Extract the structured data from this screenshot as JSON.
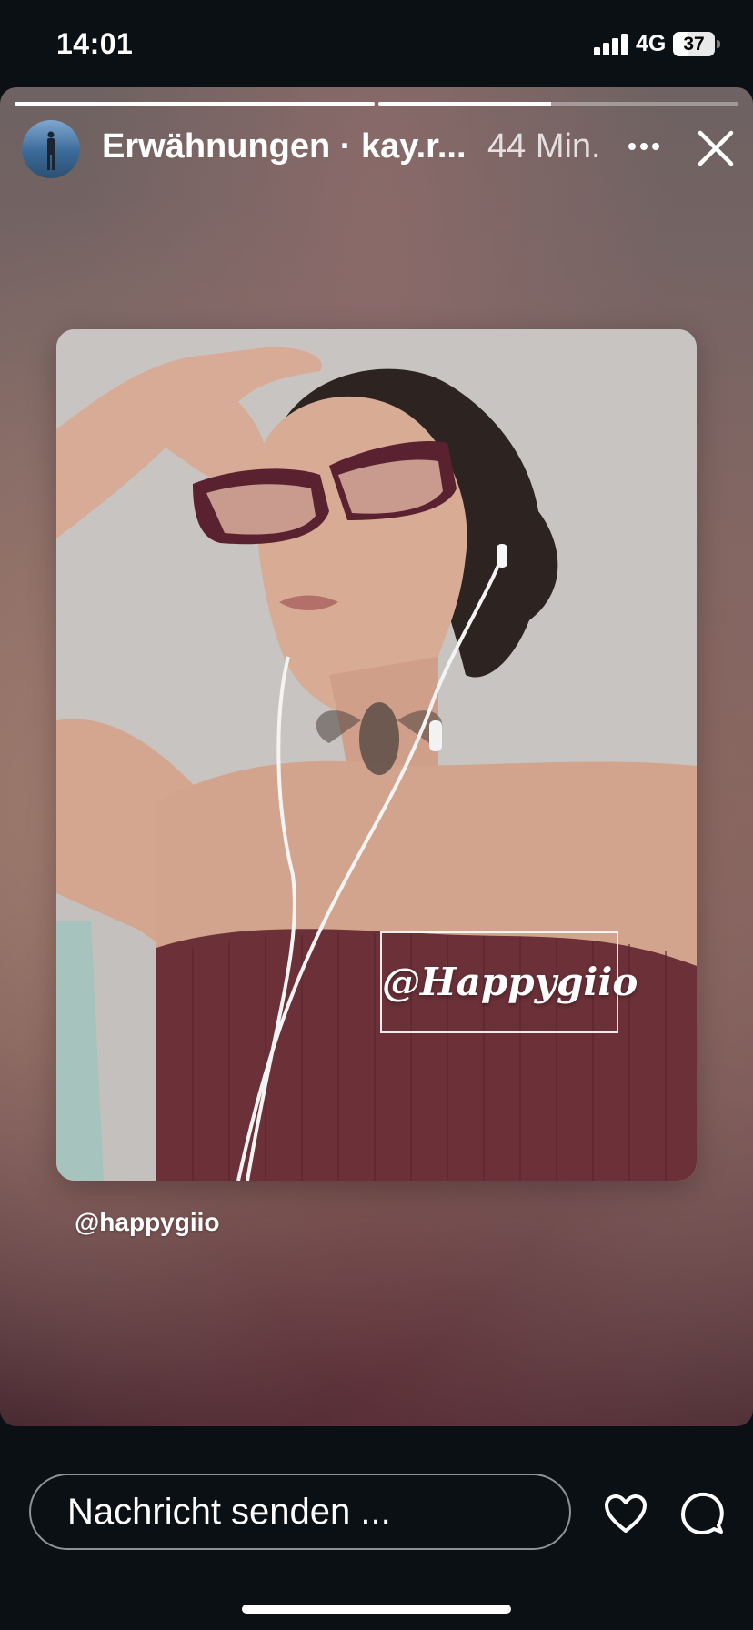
{
  "status_bar": {
    "time": "14:01",
    "network": "4G",
    "battery_percent": "37",
    "battery_level": 0.37,
    "signal_icon": "cellular-signal-icon"
  },
  "story": {
    "progress": [
      1.0,
      0.48
    ],
    "header": {
      "title": "Erwähnungen · kay.r...",
      "time_ago": "44 Min.",
      "avatar_icon": "profile-avatar",
      "more_icon": "ellipsis-icon",
      "close_icon": "close-icon"
    },
    "photo": {
      "tag_text": "@Happygiio"
    },
    "mention": "@happygiio"
  },
  "footer": {
    "message_placeholder": "Nachricht senden ...",
    "like_icon": "heart-icon",
    "comment_icon": "comment-icon"
  },
  "colors": {
    "background": "#0b1014",
    "text": "#ffffff",
    "top_color": "#6b3038"
  }
}
